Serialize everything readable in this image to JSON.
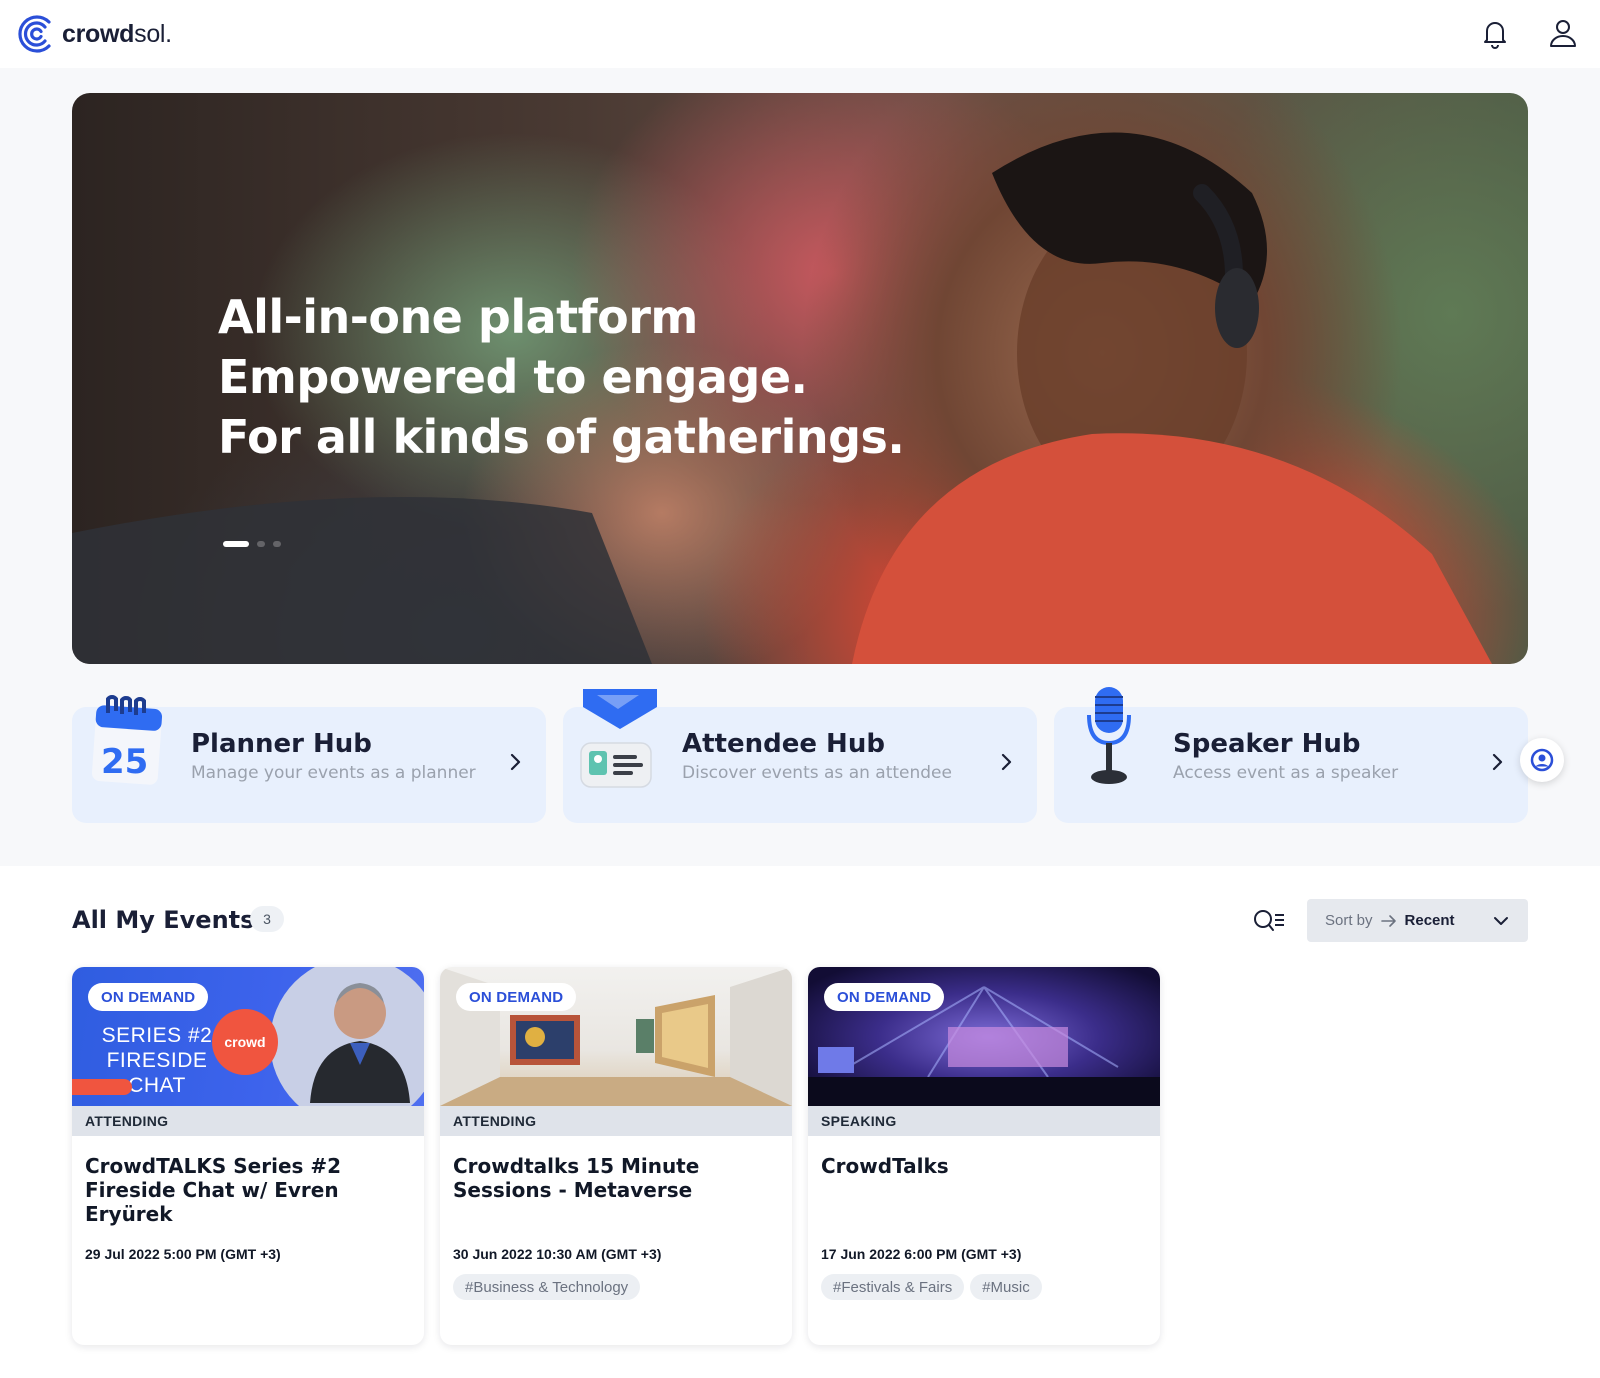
{
  "header": {
    "logo_text_bold": "crowd",
    "logo_text_light": "sol.",
    "icons": [
      "bell-icon",
      "user-icon"
    ]
  },
  "hero": {
    "lines": [
      "All-in-one platform",
      "Empowered to engage.",
      "For all kinds of gatherings."
    ],
    "slide_count": 3,
    "active_slide": 1
  },
  "hubs": [
    {
      "title": "Planner Hub",
      "subtitle": "Manage your events as a planner",
      "icon": "calendar-icon",
      "calendar_day": "25"
    },
    {
      "title": "Attendee Hub",
      "subtitle": "Discover events as an attendee",
      "icon": "badge-icon"
    },
    {
      "title": "Speaker Hub",
      "subtitle": "Access event as a speaker",
      "icon": "microphone-icon"
    }
  ],
  "events_section": {
    "title": "All My Events",
    "count": "3",
    "sort_label": "Sort by",
    "sort_value": "Recent"
  },
  "events": [
    {
      "badge": "ON DEMAND",
      "role": "ATTENDING",
      "title": "CrowdTALKS Series #2 Fireside Chat w/ Evren Eryürek",
      "date": "29 Jul 2022 5:00 PM (GMT +3)",
      "tags": [],
      "thumb_text": [
        "SERIES #2",
        "FIRESIDE",
        "CHAT"
      ],
      "thumb_logo": "crowd"
    },
    {
      "badge": "ON DEMAND",
      "role": "ATTENDING",
      "title": "Crowdtalks 15 Minute Sessions - Metaverse",
      "date": "30 Jun 2022 10:30 AM (GMT +3)",
      "tags": [
        "#Business & Technology"
      ]
    },
    {
      "badge": "ON DEMAND",
      "role": "SPEAKING",
      "title": "CrowdTalks",
      "date": "17 Jun 2022 6:00 PM (GMT +3)",
      "tags": [
        "#Festivals & Fairs",
        "#Music"
      ]
    }
  ],
  "colors": {
    "brand_blue": "#2b4fd8",
    "hub_bg": "#e8f0fd",
    "accent_red": "#f0553f"
  }
}
